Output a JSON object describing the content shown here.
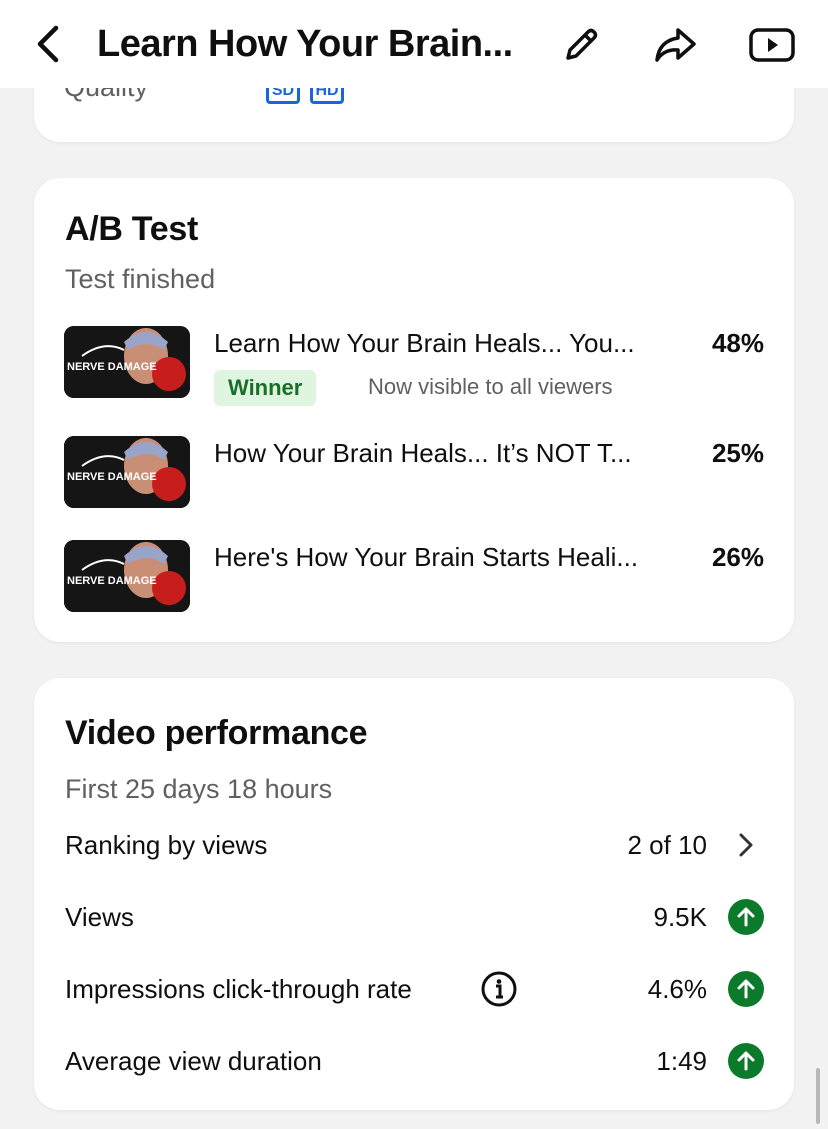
{
  "header": {
    "title": "Learn How Your Brain..."
  },
  "quality": {
    "label": "Quality",
    "badges": [
      "SD",
      "HD"
    ]
  },
  "ab_test": {
    "title": "A/B Test",
    "status": "Test finished",
    "variants": [
      {
        "title": "Learn How Your Brain Heals... You...",
        "percent": "48%",
        "winner_label": "Winner",
        "winner_note": "Now visible to all viewers",
        "thumb_text": "NERVE DAMAGE"
      },
      {
        "title": "How Your Brain Heals... It’s NOT T...",
        "percent": "25%",
        "thumb_text": "NERVE DAMAGE"
      },
      {
        "title": "Here's How Your Brain Starts Heali...",
        "percent": "26%",
        "thumb_text": "NERVE DAMAGE"
      }
    ]
  },
  "performance": {
    "title": "Video performance",
    "period": "First 25 days 18 hours",
    "rows": [
      {
        "label": "Ranking by views",
        "value": "2 of 10",
        "icon": "chevron-right-icon"
      },
      {
        "label": "Views",
        "value": "9.5K",
        "icon": "arrow-up-circle-icon"
      },
      {
        "label": "Impressions click-through rate",
        "value": "4.6%",
        "icon": "arrow-up-circle-icon"
      },
      {
        "label": "Average view duration",
        "value": "1:49",
        "icon": "arrow-up-circle-icon"
      }
    ]
  },
  "colors": {
    "accent_green": "#0b7a2a",
    "winner_bg": "#dff5df",
    "quality_blue": "#1a66d9"
  }
}
